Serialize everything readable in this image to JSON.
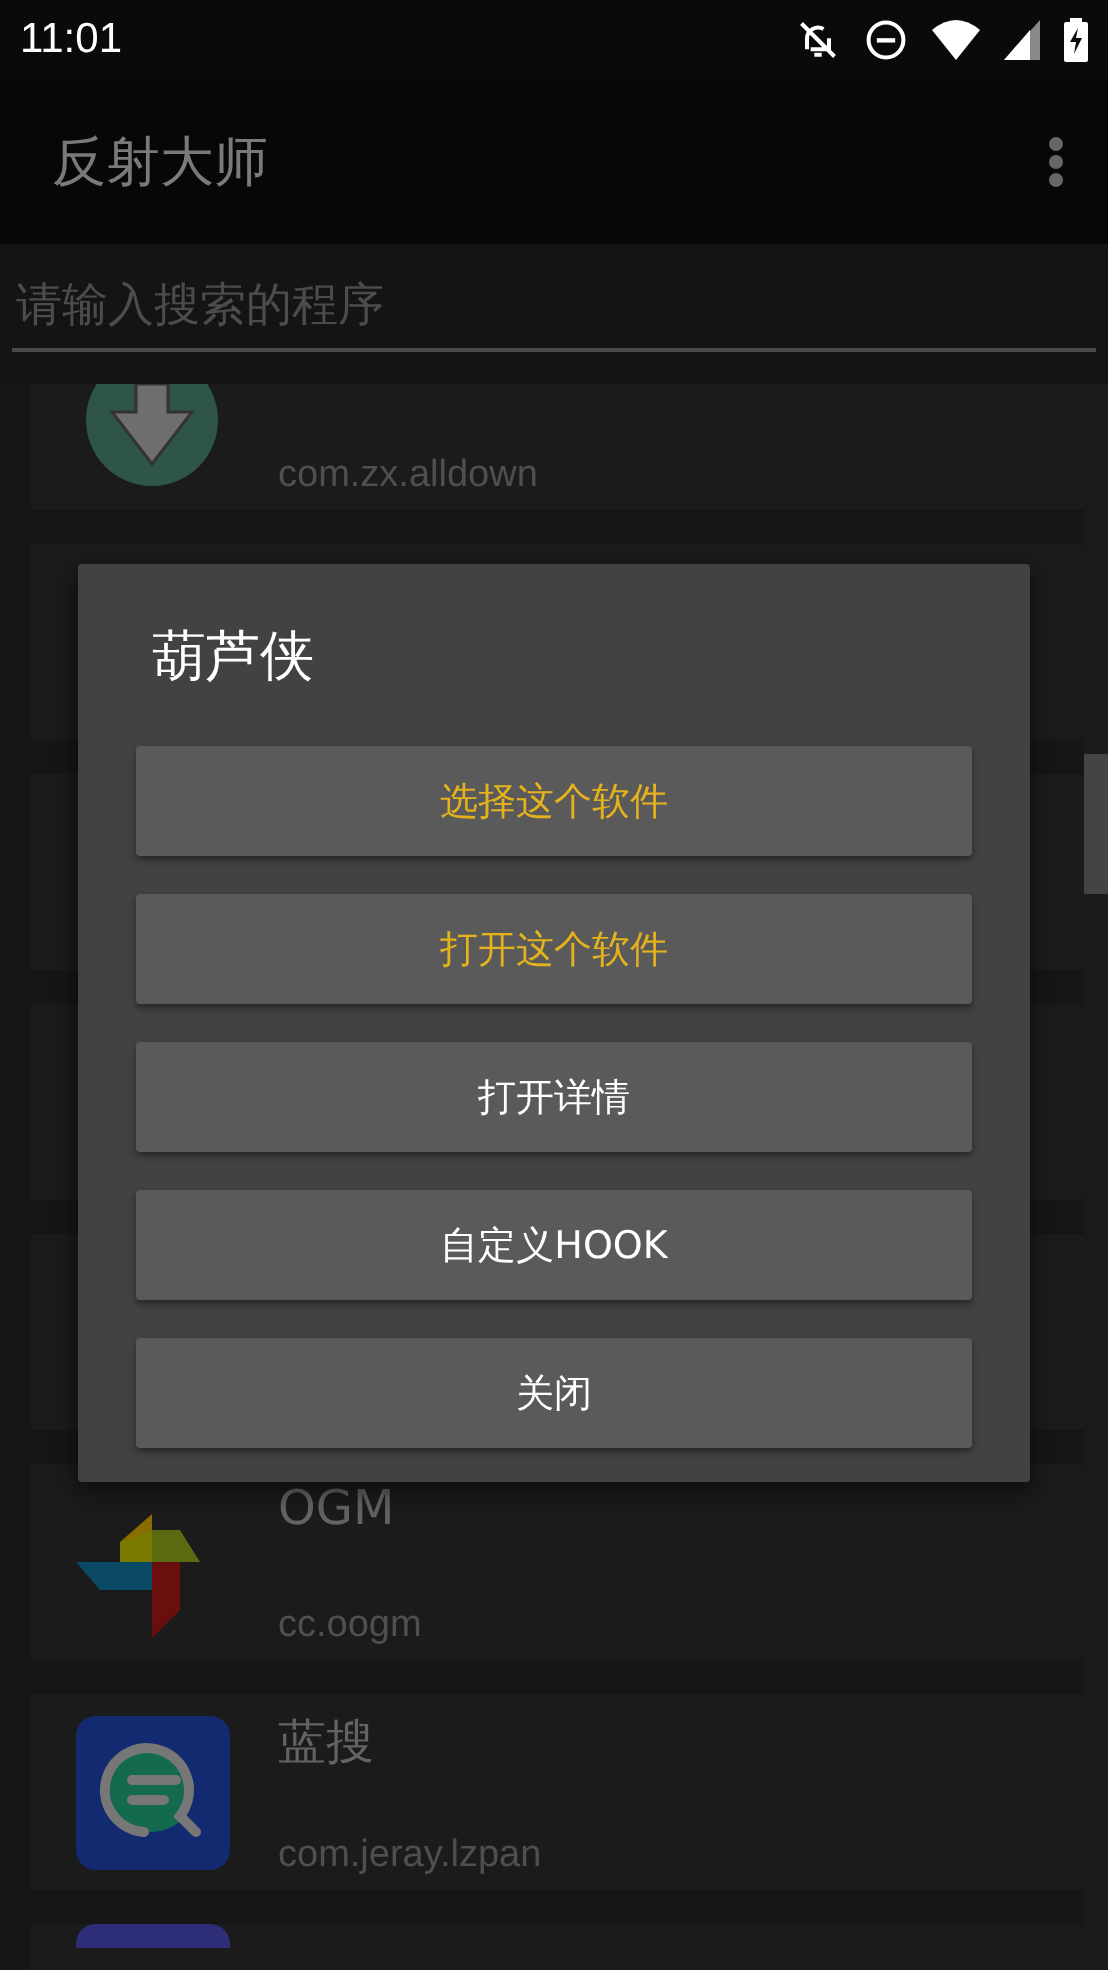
{
  "status_bar": {
    "time": "11:01"
  },
  "app_bar": {
    "title": "反射大师"
  },
  "search": {
    "placeholder": "请输入搜索的程序"
  },
  "apps": [
    {
      "kind": "top-cut",
      "package": "com.zx.alldown"
    },
    {
      "kind": "covered"
    },
    {
      "kind": "covered"
    },
    {
      "kind": "covered"
    },
    {
      "kind": "covered"
    },
    {
      "kind": "full",
      "name": "OGM",
      "package": "cc.oogm"
    },
    {
      "kind": "full",
      "name": "蓝搜",
      "package": "com.jeray.lzpan"
    },
    {
      "kind": "bottom-cut"
    }
  ],
  "dialog": {
    "title": "葫芦侠",
    "buttons": [
      {
        "label": "选择这个软件",
        "kind": "accent"
      },
      {
        "label": "打开这个软件",
        "kind": "accent"
      },
      {
        "label": "打开详情",
        "kind": "plain"
      },
      {
        "label": "自定义HOOK",
        "kind": "plain"
      },
      {
        "label": "关闭",
        "kind": "plain"
      }
    ]
  }
}
